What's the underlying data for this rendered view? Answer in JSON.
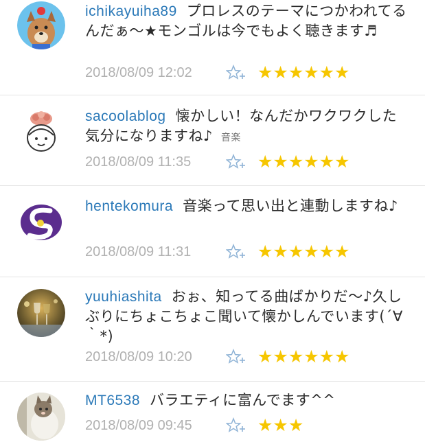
{
  "comments": [
    {
      "user": "ichikayuiha89",
      "text": "プロレスのテーマにつかわれてるんだぁ～★モンゴルは今でもよく聴きます♬",
      "tag": "",
      "date": "2018/08/09 12:02",
      "stars": "★★★★★★",
      "avatar": "dog-mascot-avatar"
    },
    {
      "user": "sacoolablog",
      "text": "懐かしい！なんだかワクワクした気分になりますね♪",
      "tag": "音楽",
      "date": "2018/08/09 11:35",
      "stars": "★★★★★★",
      "avatar": "cartoon-face-avatar"
    },
    {
      "user": "hentekomura",
      "text": "音楽って思い出と連動しますね♪",
      "tag": "",
      "date": "2018/08/09 11:31",
      "stars": "★★★★★★",
      "avatar": "purple-s-logo-avatar"
    },
    {
      "user": "yuuhiashita",
      "text": "おぉ、知ってる曲ばかりだ～♪久しぶりにちょこちょこ聞いて懐かしんでいます(´∀｀*)",
      "tag": "",
      "date": "2018/08/09 10:20",
      "stars": "★★★★★★",
      "avatar": "wine-glass-photo-avatar"
    },
    {
      "user": "MT6538",
      "text": "バラエティに富んでます^^",
      "tag": "",
      "date": "2018/08/09 09:45",
      "stars": "★★★",
      "avatar": "cat-photo-avatar"
    }
  ],
  "icons": {
    "add_star": "star-plus-icon"
  },
  "colors": {
    "username": "#2b79b8",
    "star": "#f6c600",
    "date": "#b1b1b1",
    "add_star": "#8fb3d6"
  }
}
